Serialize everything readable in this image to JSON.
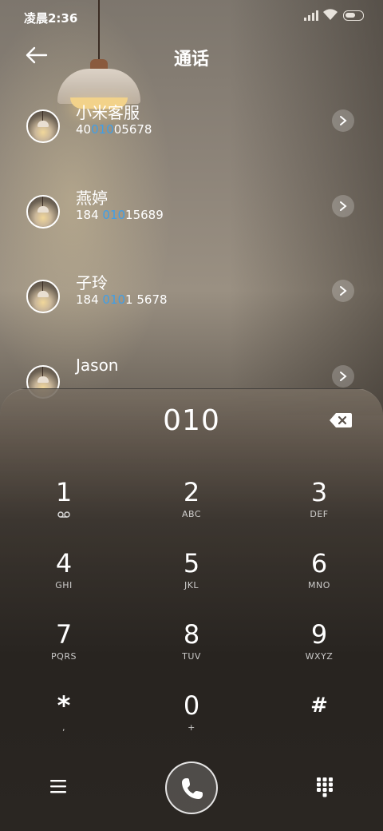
{
  "status_bar": {
    "time": "凌晨2:36"
  },
  "header": {
    "title": "通话"
  },
  "contacts": [
    {
      "name": "小米客服",
      "number_pre": "40",
      "number_match": "010",
      "number_post": "05678"
    },
    {
      "name": "燕婷",
      "number_pre": "184 ",
      "number_match": "010",
      "number_post": "15689"
    },
    {
      "name": "子玲",
      "number_pre": "184 ",
      "number_match": "010",
      "number_post": "1 5678"
    },
    {
      "name": "Jason",
      "number_pre": "",
      "number_match": "",
      "number_post": ""
    }
  ],
  "dialer": {
    "input": "010",
    "keys": [
      {
        "digit": "1",
        "letters": "",
        "icon": "voicemail-icon"
      },
      {
        "digit": "2",
        "letters": "ABC"
      },
      {
        "digit": "3",
        "letters": "DEF"
      },
      {
        "digit": "4",
        "letters": "GHI"
      },
      {
        "digit": "5",
        "letters": "JKL"
      },
      {
        "digit": "6",
        "letters": "MNO"
      },
      {
        "digit": "7",
        "letters": "PQRS"
      },
      {
        "digit": "8",
        "letters": "TUV"
      },
      {
        "digit": "9",
        "letters": "WXYZ"
      },
      {
        "digit": "*",
        "letters": ","
      },
      {
        "digit": "0",
        "letters": "+"
      },
      {
        "digit": "#",
        "letters": ""
      }
    ]
  },
  "colors": {
    "match_highlight": "#3f9fe8",
    "text": "#ffffff"
  },
  "icons": [
    "back-arrow-icon",
    "chevron-right-icon",
    "backspace-icon",
    "menu-icon",
    "phone-icon",
    "keypad-icon",
    "signal-icon",
    "wifi-icon",
    "battery-icon"
  ]
}
